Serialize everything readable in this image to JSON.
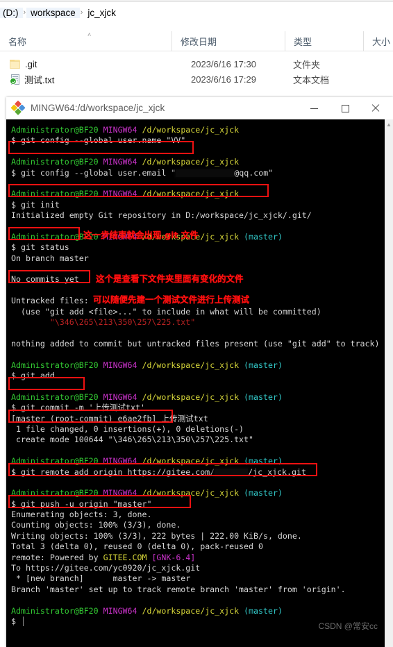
{
  "explorer": {
    "breadcrumb": {
      "segments": [
        "(D:)",
        "workspace",
        "jc_xjck"
      ],
      "separator": "›"
    },
    "columns": [
      {
        "label": "名称",
        "key": "name"
      },
      {
        "label": "修改日期",
        "key": "date"
      },
      {
        "label": "类型",
        "key": "type"
      },
      {
        "label": "大小",
        "key": "size"
      }
    ],
    "sort_caret": "˄",
    "rows": [
      {
        "name": ".git",
        "date": "2023/6/16 17:30",
        "type": "文件夹",
        "size": "",
        "icon": "folder-icon"
      },
      {
        "name": "测试.txt",
        "date": "2023/6/16 17:29",
        "type": "文本文档",
        "size": "",
        "icon": "text-document-icon"
      }
    ]
  },
  "terminal": {
    "title": "MINGW64:/d/workspace/jc_xjck",
    "icon": "git-bash-icon",
    "window_controls": {
      "minimize": "minimize-icon",
      "maximize": "maximize-icon",
      "close": "close-icon"
    },
    "prompt": {
      "user_host": "Administrator@BF20",
      "shell": "MINGW64",
      "path": "/d/workspace/jc_xjck",
      "branch": "(master)",
      "symbol": "$"
    },
    "lines": [
      {
        "type": "prompt",
        "branch": false
      },
      {
        "type": "cmd",
        "text": "$ git config --global user.name \"VV\""
      },
      {
        "type": "blank"
      },
      {
        "type": "prompt",
        "branch": false
      },
      {
        "type": "cmd_redacted",
        "pre": "$ git config --global user.email \"",
        "post": "@qq.com\""
      },
      {
        "type": "blank"
      },
      {
        "type": "prompt",
        "branch": false
      },
      {
        "type": "cmd",
        "text": "$ git init"
      },
      {
        "type": "out",
        "text": "Initialized empty Git repository in D:/workspace/jc_xjck/.git/"
      },
      {
        "type": "blank"
      },
      {
        "type": "prompt",
        "branch": true
      },
      {
        "type": "cmd",
        "text": "$ git status"
      },
      {
        "type": "out",
        "text": "On branch master"
      },
      {
        "type": "blank"
      },
      {
        "type": "out",
        "text": "No commits yet"
      },
      {
        "type": "blank"
      },
      {
        "type": "out",
        "text": "Untracked files:"
      },
      {
        "type": "out",
        "text": "  (use \"git add <file>...\" to include in what will be committed)"
      },
      {
        "type": "out_red",
        "text": "        \"\\346\\265\\213\\350\\257\\225.txt\""
      },
      {
        "type": "blank"
      },
      {
        "type": "out",
        "text": "nothing added to commit but untracked files present (use \"git add\" to track)"
      },
      {
        "type": "blank"
      },
      {
        "type": "prompt",
        "branch": true
      },
      {
        "type": "cmd",
        "text": "$ git add ."
      },
      {
        "type": "blank"
      },
      {
        "type": "prompt",
        "branch": true
      },
      {
        "type": "cmd",
        "text": "$ git commit -m '上传测试txt'"
      },
      {
        "type": "out",
        "text": "[master (root-commit) e6ae2fb] 上传测试txt"
      },
      {
        "type": "out",
        "text": " 1 file changed, 0 insertions(+), 0 deletions(-)"
      },
      {
        "type": "out",
        "text": " create mode 100644 \"\\346\\265\\213\\350\\257\\225.txt\""
      },
      {
        "type": "blank"
      },
      {
        "type": "prompt",
        "branch": true
      },
      {
        "type": "cmd_redacted2",
        "pre": "$ git remote add origin https://gitee.com/",
        "post": "/jc_xjck.git"
      },
      {
        "type": "blank"
      },
      {
        "type": "prompt",
        "branch": true
      },
      {
        "type": "cmd",
        "text": "$ git push -u origin \"master\""
      },
      {
        "type": "out",
        "text": "Enumerating objects: 3, done."
      },
      {
        "type": "out",
        "text": "Counting objects: 100% (3/3), done."
      },
      {
        "type": "out",
        "text": "Writing objects: 100% (3/3), 222 bytes | 222.00 KiB/s, done."
      },
      {
        "type": "out",
        "text": "Total 3 (delta 0), reused 0 (delta 0), pack-reused 0"
      },
      {
        "type": "remote_gitee",
        "pre": "remote: Powered by ",
        "mid": "GITEE.COM",
        "post": "[GNK-6.4]"
      },
      {
        "type": "out",
        "text": "To https://gitee.com/yc0920/jc_xjck.git"
      },
      {
        "type": "out",
        "text": " * [new branch]      master -> master"
      },
      {
        "type": "out",
        "text": "Branch 'master' set up to track remote branch 'master' from 'origin'."
      },
      {
        "type": "blank"
      },
      {
        "type": "prompt",
        "branch": true
      },
      {
        "type": "cmd_cursor",
        "text": "$ "
      }
    ],
    "annotations": [
      {
        "id": "note-git-init",
        "text": "这一步结束就会出现.git 文件"
      },
      {
        "id": "note-git-status",
        "text": "这个是查看下文件夹里面有变化的文件"
      },
      {
        "id": "note-new-file",
        "text": "可以随便先建一个测试文件进行上传测试"
      }
    ],
    "highlight_color": "#ee1111",
    "annotation_color": "#ff1111"
  },
  "watermark": "CSDN @常安cc"
}
